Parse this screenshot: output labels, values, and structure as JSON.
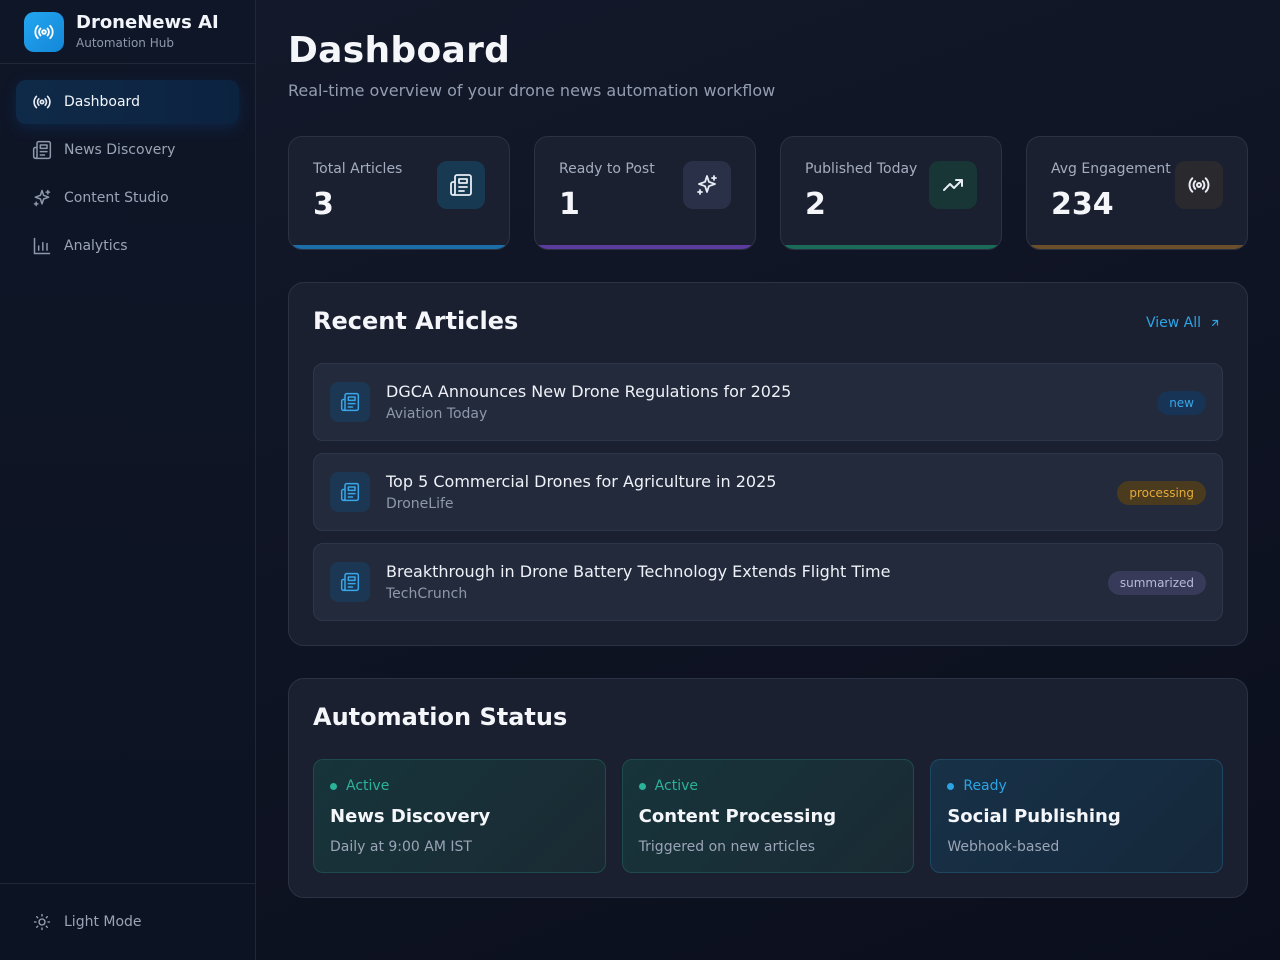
{
  "brand": {
    "title": "DroneNews AI",
    "subtitle": "Automation Hub",
    "icon": "broadcast-icon"
  },
  "nav": {
    "items": [
      {
        "label": "Dashboard",
        "icon": "broadcast-icon",
        "active": true
      },
      {
        "label": "News Discovery",
        "icon": "newspaper-icon",
        "active": false
      },
      {
        "label": "Content Studio",
        "icon": "sparkles-icon",
        "active": false
      },
      {
        "label": "Analytics",
        "icon": "bar-chart-icon",
        "active": false
      }
    ]
  },
  "footer": {
    "theme_label": "Light Mode",
    "icon": "sun-icon"
  },
  "header": {
    "title": "Dashboard",
    "subtitle": "Real-time overview of your drone news automation workflow"
  },
  "stats": [
    {
      "label": "Total Articles",
      "value": "3",
      "icon": "newspaper-icon",
      "accent": "#1b6ea8"
    },
    {
      "label": "Ready to Post",
      "value": "1",
      "icon": "sparkles-icon",
      "accent": "#5b3c9e"
    },
    {
      "label": "Published Today",
      "value": "2",
      "icon": "trending-up-icon",
      "accent": "#1a6b57"
    },
    {
      "label": "Avg Engagement",
      "value": "234",
      "icon": "broadcast-icon",
      "accent": "#6b4f2a"
    }
  ],
  "recent": {
    "title": "Recent Articles",
    "view_all": "View All",
    "articles": [
      {
        "title": "DGCA Announces New Drone Regulations for 2025",
        "source": "Aviation Today",
        "status": "new"
      },
      {
        "title": "Top 5 Commercial Drones for Agriculture in 2025",
        "source": "DroneLife",
        "status": "processing"
      },
      {
        "title": "Breakthrough in Drone Battery Technology Extends Flight Time",
        "source": "TechCrunch",
        "status": "summarized"
      }
    ]
  },
  "automation": {
    "title": "Automation Status",
    "items": [
      {
        "status": "Active",
        "name": "News Discovery",
        "desc": "Daily at 9:00 AM IST",
        "color": "#2bb39a"
      },
      {
        "status": "Active",
        "name": "Content Processing",
        "desc": "Triggered on new articles",
        "color": "#2bb39a"
      },
      {
        "status": "Ready",
        "name": "Social Publishing",
        "desc": "Webhook-based",
        "color": "#2ba4e6"
      }
    ]
  },
  "colors": {
    "accent": "#2ba4e6",
    "background": "#0f1424",
    "card": "#1a2030"
  }
}
